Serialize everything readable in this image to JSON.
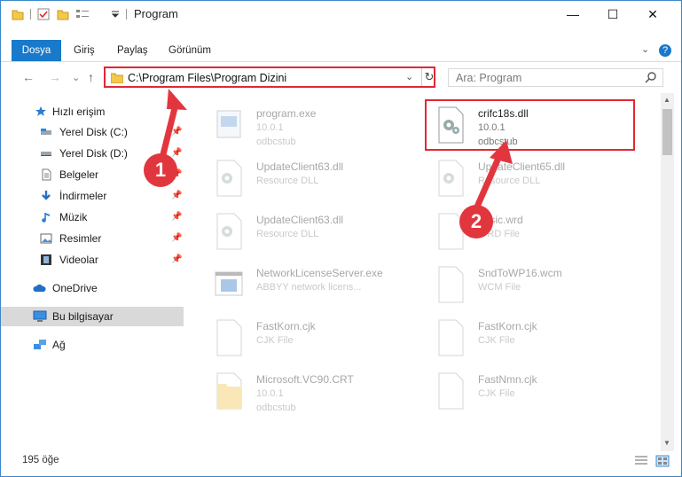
{
  "window": {
    "title": "Program",
    "controls": {
      "minimize": "—",
      "maximize": "☐",
      "close": "✕"
    }
  },
  "ribbon": {
    "tabs": [
      "Dosya",
      "Giriş",
      "Paylaş",
      "Görünüm"
    ],
    "expand": "⌄",
    "help": "?"
  },
  "address": {
    "path": "C:\\Program Files\\Program Dizini",
    "chevron": "⌄",
    "refresh": "↻"
  },
  "nav_buttons": {
    "back": "←",
    "forward": "→",
    "recent": "⌄",
    "up": "↑"
  },
  "search": {
    "placeholder": "Ara: Program"
  },
  "sidebar": {
    "items": [
      {
        "label": "Hızlı erişim",
        "icon": "star-icon"
      },
      {
        "label": "Yerel Disk (C:)",
        "icon": "drive-icon",
        "pinned": true
      },
      {
        "label": "Yerel Disk (D:)",
        "icon": "drive-icon",
        "pinned": true
      },
      {
        "label": "Belgeler",
        "icon": "document-icon",
        "pinned": true
      },
      {
        "label": "İndirmeler",
        "icon": "download-icon",
        "pinned": true
      },
      {
        "label": "Müzik",
        "icon": "music-icon",
        "pinned": true
      },
      {
        "label": "Resimler",
        "icon": "pictures-icon",
        "pinned": true
      },
      {
        "label": "Videolar",
        "icon": "video-icon",
        "pinned": true
      },
      {
        "label": "OneDrive",
        "icon": "cloud-icon"
      },
      {
        "label": "Bu bilgisayar",
        "icon": "computer-icon",
        "selected": true
      },
      {
        "label": "Ağ",
        "icon": "network-icon"
      }
    ],
    "pin_glyph": "📌"
  },
  "files": [
    {
      "name": "program.exe",
      "sub1": "10.0.1",
      "sub2": "odbcstub",
      "icon": "exe-icon",
      "faded": true
    },
    {
      "name": "crifc18s.dll",
      "sub1": "10.0.1",
      "sub2": "odbcstub",
      "icon": "dll-icon",
      "faded": false
    },
    {
      "name": "UpdateClient63.dll",
      "sub1": "Resource DLL",
      "sub2": "",
      "icon": "dll-icon",
      "faded": true
    },
    {
      "name": "UpdateClient65.dll",
      "sub1": "Resource DLL",
      "sub2": "",
      "icon": "dll-icon",
      "faded": true
    },
    {
      "name": "UpdateClient63.dll",
      "sub1": "Resource DLL",
      "sub2": "",
      "icon": "dll-icon",
      "faded": true
    },
    {
      "name": "basic.wrd",
      "sub1": "WRD File",
      "sub2": "",
      "icon": "blank-file-icon",
      "faded": true
    },
    {
      "name": "NetworkLicenseServer.exe",
      "sub1": "ABBYY network licens...",
      "sub2": "",
      "icon": "app-window-icon",
      "faded": true
    },
    {
      "name": "SndToWP16.wcm",
      "sub1": "WCM File",
      "sub2": "",
      "icon": "blank-file-icon",
      "faded": true
    },
    {
      "name": "FastKorn.cjk",
      "sub1": "CJK File",
      "sub2": "",
      "icon": "blank-file-icon",
      "faded": true
    },
    {
      "name": "FastKorn.cjk",
      "sub1": "CJK File",
      "sub2": "",
      "icon": "blank-file-icon",
      "faded": true
    },
    {
      "name": "Microsoft.VC90.CRT",
      "sub1": "10.0.1",
      "sub2": "odbcstub",
      "icon": "folder-file-icon",
      "faded": true
    },
    {
      "name": "FastNmn.cjk",
      "sub1": "CJK File",
      "sub2": "",
      "icon": "blank-file-icon",
      "faded": true
    }
  ],
  "status": {
    "item_count": "195 öğe"
  },
  "annotations": [
    {
      "number": "1",
      "color": "#e2363f"
    },
    {
      "number": "2",
      "color": "#e2363f"
    }
  ],
  "colors": {
    "accent": "#1979ca",
    "highlight": "#e22733",
    "selected": "#d9d9d9"
  }
}
